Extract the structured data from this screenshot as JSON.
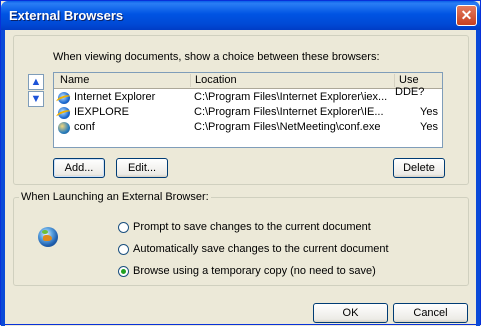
{
  "window": {
    "title": "External Browsers",
    "close_glyph": "✕"
  },
  "intro_text": "When viewing documents, show a choice between these browsers:",
  "order_buttons": {
    "up_glyph": "▲",
    "down_glyph": "▼",
    "up_icon": "arrow-up-icon",
    "down_icon": "arrow-down-icon"
  },
  "list": {
    "columns": [
      "Name",
      "Location",
      "Use DDE?"
    ],
    "rows": [
      {
        "name": "Internet Explorer",
        "location": "C:\\Program Files\\Internet Explorer\\iex...",
        "dde": "",
        "icon": "internet-explorer-icon"
      },
      {
        "name": "IEXPLORE",
        "location": "C:\\Program Files\\Internet Explorer\\IE...",
        "dde": "Yes",
        "icon": "internet-explorer-icon"
      },
      {
        "name": "conf",
        "location": "C:\\Program Files\\NetMeeting\\conf.exe",
        "dde": "Yes",
        "icon": "netmeeting-icon"
      }
    ]
  },
  "buttons": {
    "add": "Add...",
    "edit": "Edit...",
    "delete": "Delete",
    "ok": "OK",
    "cancel": "Cancel"
  },
  "launch_group": {
    "legend": "When Launching an External Browser:",
    "options": [
      "Prompt to save changes to the current document",
      "Automatically save changes to the current document",
      "Browse using a temporary copy (no need to save)"
    ],
    "selected_index": 2
  },
  "colors": {
    "title_bar": "#0054e3",
    "dialog_bg": "#ece9d8",
    "close_button": "#c7401f"
  }
}
